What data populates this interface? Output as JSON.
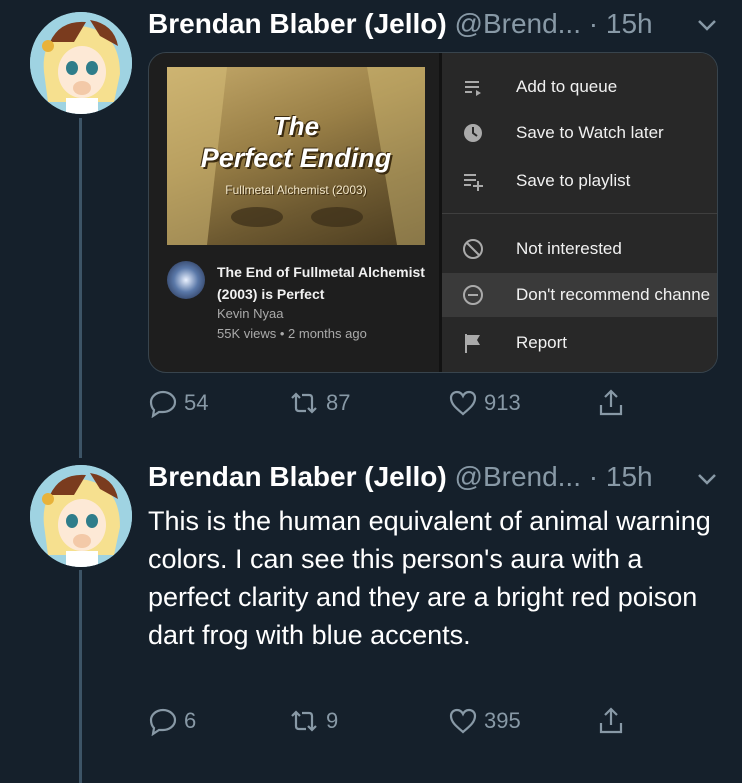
{
  "tweets": [
    {
      "author_name": "Brendan Blaber (Jello)",
      "author_meta": "@Brend... · 15h",
      "embed": {
        "thumbnail_title_line1": "The",
        "thumbnail_title_line2": "Perfect Ending",
        "thumbnail_subtitle": "Fullmetal Alchemist (2003)",
        "video_title": "The End of Fullmetal Alchemist (2003) is Perfect",
        "channel": "Kevin Nyaa",
        "views": "55K views • 2 months ago",
        "menu": [
          {
            "label": "Add to queue",
            "icon": "queue-icon"
          },
          {
            "label": "Save to Watch later",
            "icon": "clock-icon"
          },
          {
            "label": "Save to playlist",
            "icon": "playlist-add-icon"
          },
          {
            "label": "Not interested",
            "icon": "block-icon"
          },
          {
            "label": "Don't recommend channe",
            "icon": "minus-circle-icon"
          },
          {
            "label": "Report",
            "icon": "flag-icon"
          }
        ]
      },
      "replies": "54",
      "retweets": "87",
      "likes": "913"
    },
    {
      "author_name": "Brendan Blaber (Jello)",
      "author_meta": "@Brend... · 15h",
      "text": "This is the human equivalent of animal warning colors. I can see this person's aura with a perfect clarity and they are a bright red poison dart frog with blue accents.",
      "replies": "6",
      "retweets": "9",
      "likes": "395"
    }
  ],
  "colors": {
    "background": "#15202b",
    "secondary_text": "#8899a6",
    "thread_line": "#3d5466"
  }
}
